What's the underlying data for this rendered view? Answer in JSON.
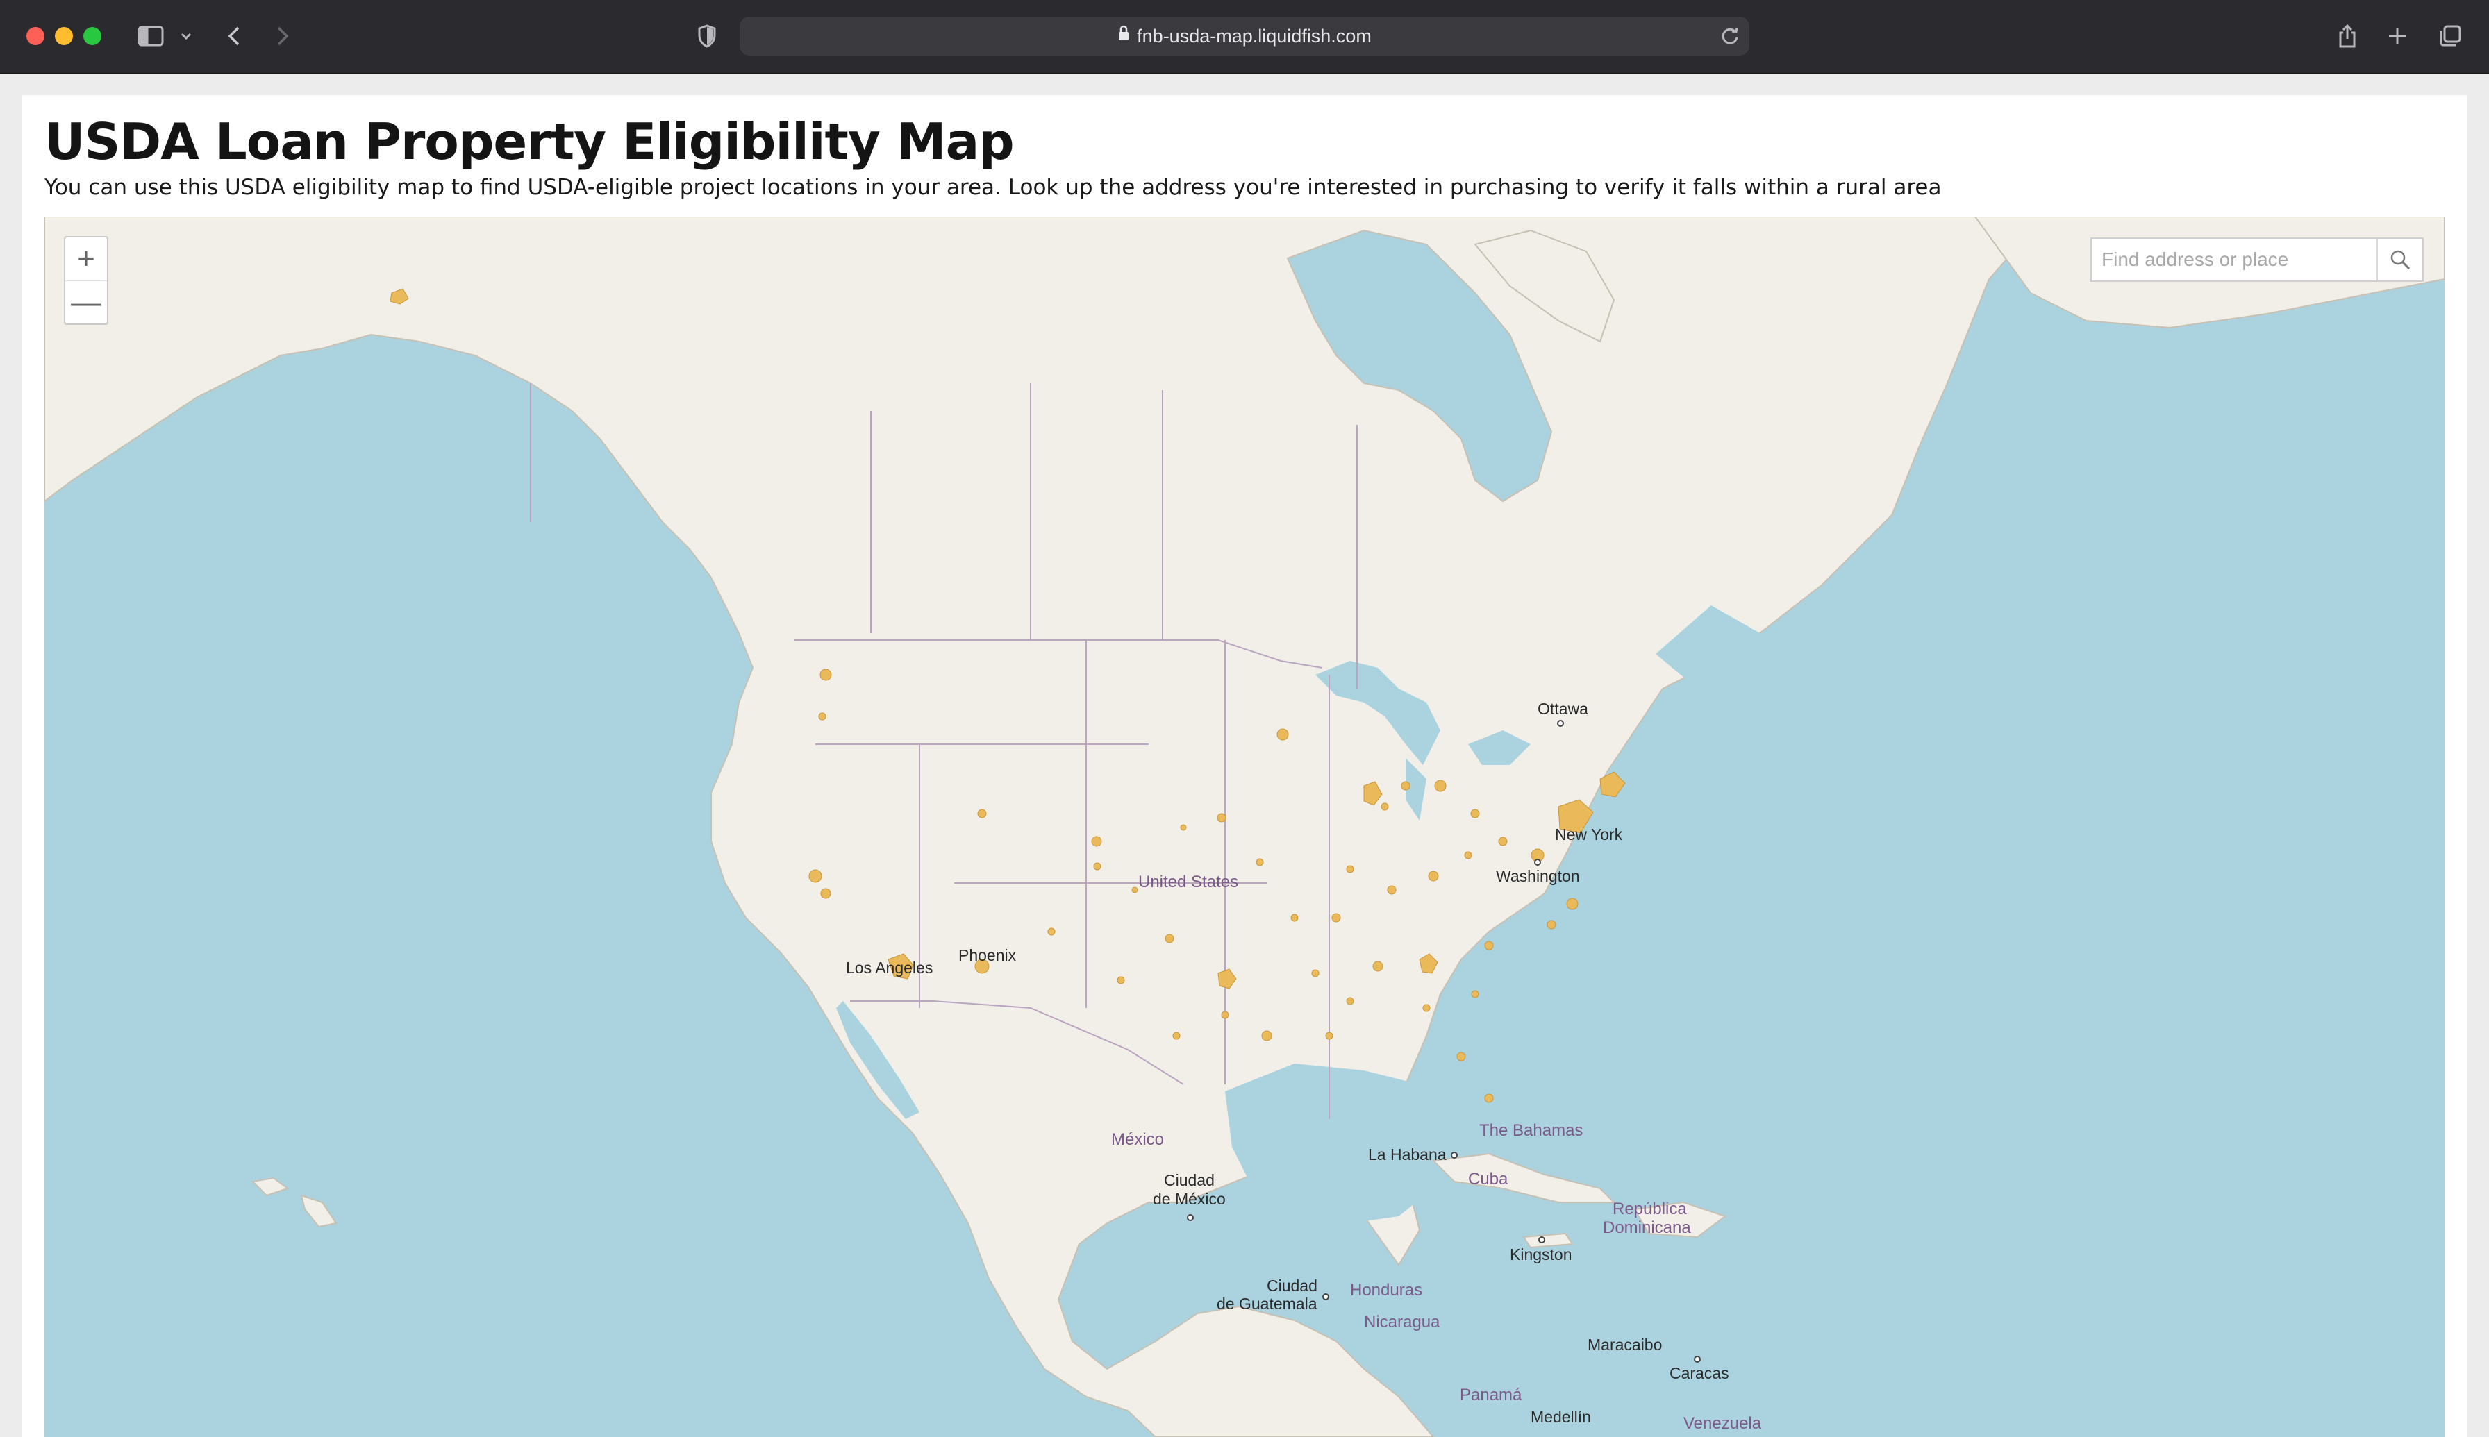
{
  "browser": {
    "url": "fnb-usda-map.liquidfish.com"
  },
  "page": {
    "title": "USDA Loan Property Eligibility Map",
    "subtitle": "You can use this USDA eligibility map to find USDA-eligible project locations in your area. Look up the address you're interested in purchasing to verify it falls within a rural area"
  },
  "map": {
    "zoom_in_label": "+",
    "zoom_out_label": "—",
    "search": {
      "placeholder": "Find address or place",
      "value": ""
    },
    "labels": {
      "ottawa": "Ottawa",
      "new_york": "New York",
      "washington": "Washington",
      "united_states": "United States",
      "phoenix": "Phoenix",
      "los_angeles": "Los Angeles",
      "mexico": "México",
      "ciudad_mexico_1": "Ciudad",
      "ciudad_mexico_2": "de México",
      "la_habana": "La Habana",
      "the_bahamas": "The Bahamas",
      "cuba": "Cuba",
      "republica_1": "República",
      "republica_2": "Dominicana",
      "kingston": "Kingston",
      "ciudad_guatemala_1": "Ciudad",
      "ciudad_guatemala_2": "de Guatemala",
      "honduras": "Honduras",
      "nicaragua": "Nicaragua",
      "maracaibo": "Maracaibo",
      "caracas": "Caracas",
      "panama": "Panamá",
      "medellin": "Medellín",
      "venezuela": "Venezuela"
    },
    "colors": {
      "water": "#aad3df",
      "land": "#f2efe9",
      "eligible_area": "#e9b95a",
      "border": "#b9a5c0"
    }
  }
}
